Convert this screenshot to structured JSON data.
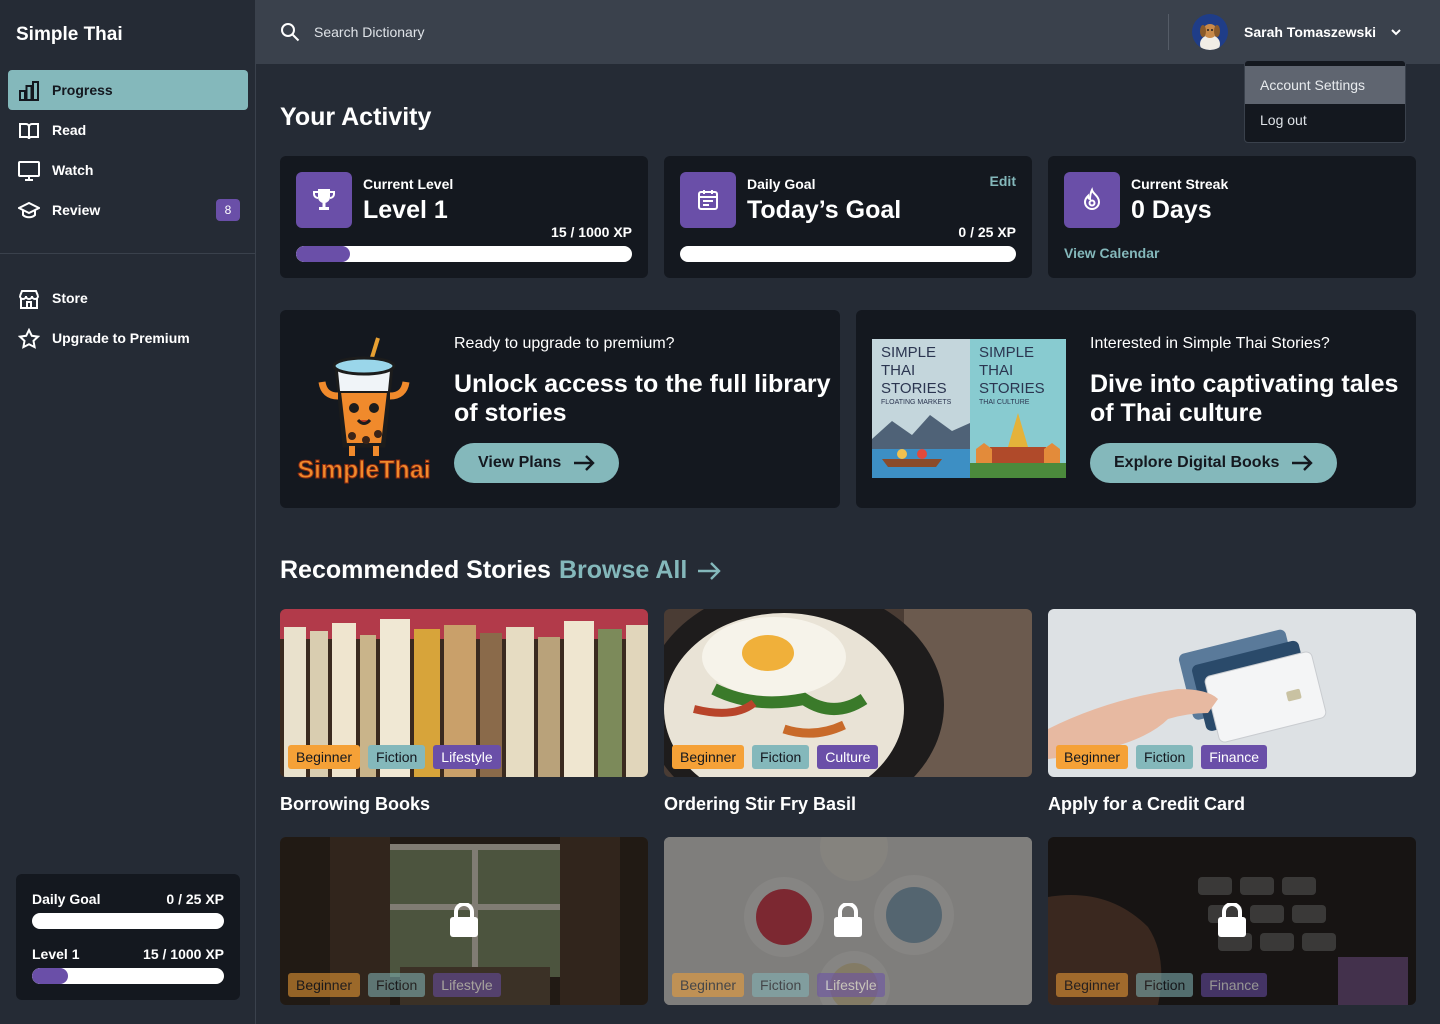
{
  "app": {
    "title": "Simple Thai"
  },
  "sidebar": {
    "items": [
      {
        "label": "Progress",
        "icon": "bar-chart-icon"
      },
      {
        "label": "Read",
        "icon": "book-icon"
      },
      {
        "label": "Watch",
        "icon": "monitor-icon"
      },
      {
        "label": "Review",
        "icon": "graduation-cap-icon",
        "badge": "8"
      }
    ],
    "secondary": [
      {
        "label": "Store",
        "icon": "store-icon"
      },
      {
        "label": "Upgrade to Premium",
        "icon": "star-icon"
      }
    ],
    "goal": {
      "daily_label": "Daily Goal",
      "daily_value": "0 / 25 XP",
      "daily_progress": 0,
      "level_label": "Level 1",
      "level_value": "15 / 1000 XP",
      "level_progress": 0.015
    }
  },
  "topbar": {
    "search_placeholder": "Search Dictionary",
    "user_name": "Sarah Tomaszewski",
    "menu": [
      "Account Settings",
      "Log out"
    ]
  },
  "activity": {
    "title": "Your Activity",
    "level": {
      "label": "Current Level",
      "value": "Level 1",
      "xp": "15 / 1000 XP",
      "progress": 0.015
    },
    "goal": {
      "label": "Daily Goal",
      "value": "Today’s Goal",
      "xp": "0 / 25 XP",
      "edit": "Edit",
      "progress": 0
    },
    "streak": {
      "label": "Current Streak",
      "value": "0 Days",
      "link": "View Calendar"
    }
  },
  "promos": [
    {
      "question": "Ready to upgrade to premium?",
      "title": "Unlock access to the full library of stories",
      "button": "View Plans",
      "logo_text": "SimpleThai"
    },
    {
      "question": "Interested in Simple Thai Stories?",
      "title": "Dive into captivating tales of Thai culture",
      "button": "Explore Digital Books",
      "books": [
        {
          "title": "SIMPLE THAI STORIES",
          "subtitle": "FLOATING MARKETS"
        },
        {
          "title": "SIMPLE THAI STORIES",
          "subtitle": "THAI CULTURE"
        }
      ]
    }
  ],
  "recommended": {
    "title": "Recommended Stories",
    "browse": "Browse All",
    "stories": [
      {
        "title": "Borrowing Books",
        "tags": [
          "Beginner",
          "Fiction",
          "Lifestyle"
        ],
        "locked": false
      },
      {
        "title": "Ordering Stir Fry Basil",
        "tags": [
          "Beginner",
          "Fiction",
          "Culture"
        ],
        "locked": false
      },
      {
        "title": "Apply for a Credit Card",
        "tags": [
          "Beginner",
          "Fiction",
          "Finance"
        ],
        "locked": false
      },
      {
        "title": "",
        "tags": [
          "Beginner",
          "Fiction",
          "Lifestyle"
        ],
        "locked": true
      },
      {
        "title": "",
        "tags": [
          "Beginner",
          "Fiction",
          "Lifestyle"
        ],
        "locked": true
      },
      {
        "title": "",
        "tags": [
          "Beginner",
          "Fiction",
          "Finance"
        ],
        "locked": true
      }
    ]
  },
  "colors": {
    "accent": "#84b8bb",
    "purple": "#6a4fa8",
    "orange": "#f5a137",
    "panel": "#14181f",
    "bg": "#252b35"
  }
}
